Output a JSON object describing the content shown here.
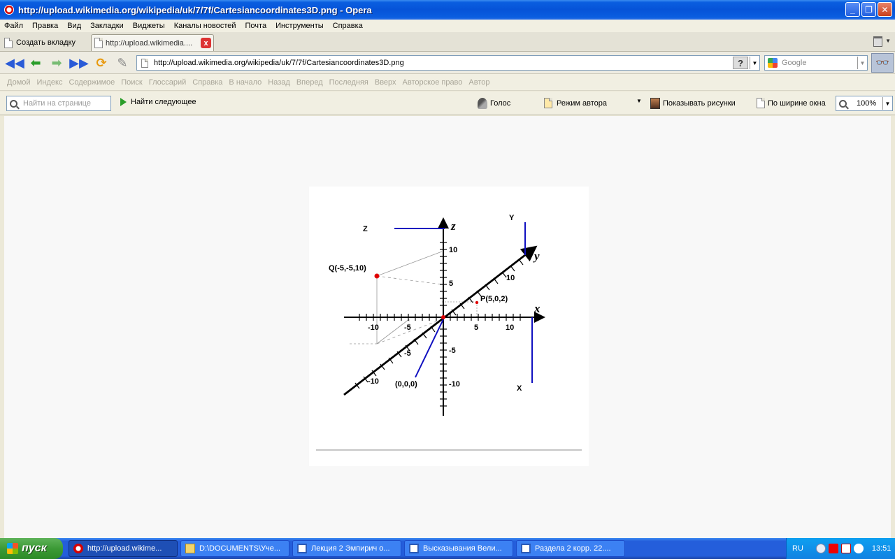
{
  "window": {
    "title": "http://upload.wikimedia.org/wikipedia/uk/7/7f/Cartesiancoordinates3D.png - Opera",
    "minimize": "_",
    "maximize": "❐",
    "close": "✕"
  },
  "menu": [
    "Файл",
    "Правка",
    "Вид",
    "Закладки",
    "Виджеты",
    "Каналы новостей",
    "Почта",
    "Инструменты",
    "Справка"
  ],
  "tabs": {
    "new_tab": "Создать вкладку",
    "active_tab": "http://upload.wikimedia....",
    "close": "x"
  },
  "address": {
    "url": "http://upload.wikimedia.org/wikipedia/uk/7/7f/Cartesiancoordinates3D.png",
    "help": "?",
    "search_placeholder": "Google"
  },
  "links": [
    "Домой",
    "Индекс",
    "Содержимое",
    "Поиск",
    "Глоссарий",
    "Справка",
    "В начало",
    "Назад",
    "Вперед",
    "Последняя",
    "Вверх",
    "Авторское право",
    "Автор"
  ],
  "findbar": {
    "find_placeholder": "Найти на странице",
    "find_next": "Найти следующее",
    "voice": "Голос",
    "author_mode": "Режим автора",
    "show_images": "Показывать рисунки",
    "fit_width": "По ширине окна",
    "zoom": "100%"
  },
  "figure": {
    "axis_x": "x",
    "axis_y": "y",
    "axis_z": "z",
    "legend_z": "Z",
    "legend_y": "Y",
    "legend_x": "X",
    "point_q": "Q(-5,-5,10)",
    "point_p": "P(5,0,2)",
    "origin": "(0,0,0)",
    "z_ticks": [
      "10",
      "5",
      "-5",
      "-10"
    ],
    "x_ticks": [
      "-10",
      "-5",
      "5",
      "10"
    ],
    "y_ticks": [
      "10",
      "-5",
      "-10"
    ],
    "colors": {
      "axis": "#000000",
      "point": "#e00000",
      "legend": "#1010c0",
      "guide": "#888888"
    }
  },
  "taskbar": {
    "start": "пуск",
    "tasks": [
      "http://upload.wikime...",
      "D:\\DOCUMENTS\\Уче...",
      "Лекция 2 Эмпирич о...",
      "Высказывания Вели...",
      "Раздела 2 корр. 22...."
    ],
    "lang": "RU",
    "clock": "13:51"
  }
}
